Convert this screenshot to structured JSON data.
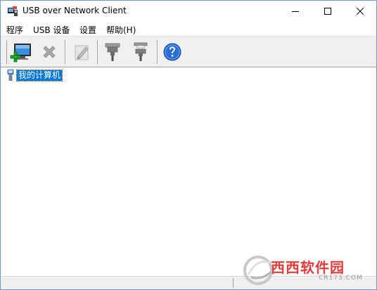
{
  "window": {
    "title": "USB over Network Client"
  },
  "menu": {
    "items": [
      {
        "label": "程序"
      },
      {
        "label": "USB 设备"
      },
      {
        "label": "设置"
      },
      {
        "label": "帮助(H)"
      }
    ]
  },
  "toolbar": {
    "buttons": [
      {
        "name": "add-server-button",
        "icon": "monitor-plus-icon"
      },
      {
        "name": "remove-button",
        "icon": "x-icon"
      },
      {
        "name": "edit-button",
        "icon": "pencil-icon"
      },
      {
        "name": "connect-button",
        "icon": "usb-plug-icon"
      },
      {
        "name": "disconnect-button",
        "icon": "usb-unplug-icon"
      },
      {
        "name": "help-button",
        "icon": "question-icon"
      }
    ]
  },
  "tree": {
    "root_label": "我的计算机"
  },
  "watermark": {
    "text": "西西软件园",
    "site": "CR173.COM"
  },
  "colors": {
    "selection": "#0078d7",
    "help_blue": "#2a6fd6",
    "watermark_red": "#e53c3c"
  }
}
